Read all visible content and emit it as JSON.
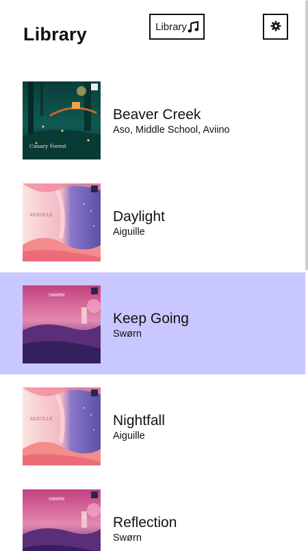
{
  "header": {
    "title": "Library",
    "library_button_label": "Library",
    "library_button_icon": "music-note-icon",
    "settings_button_icon": "gear-icon"
  },
  "colors": {
    "selected_row": "#c9c7ff"
  },
  "tracks": [
    {
      "title": "Beaver Creek",
      "artist": "Aso, Middle School, Aviino",
      "cover_text": "Canary Forest",
      "cover_style": "forest",
      "selected": false
    },
    {
      "title": "Daylight",
      "artist": "Aiguille",
      "cover_text": "AIGUILLE",
      "cover_style": "pastel",
      "selected": false
    },
    {
      "title": "Keep Going",
      "artist": "Swørn",
      "cover_text": "SWØRN",
      "cover_style": "dusk",
      "selected": true
    },
    {
      "title": "Nightfall",
      "artist": "Aiguille",
      "cover_text": "AIGUILLE",
      "cover_style": "pastel",
      "selected": false
    },
    {
      "title": "Reflection",
      "artist": "Swørn",
      "cover_text": "SWØRN",
      "cover_style": "dusk",
      "selected": false
    }
  ]
}
